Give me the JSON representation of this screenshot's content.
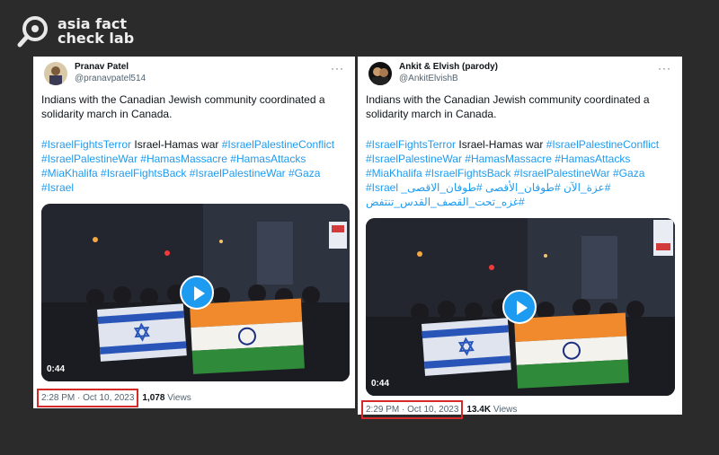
{
  "brand": {
    "line1": "asia fact",
    "line2": "check lab"
  },
  "colors": {
    "link": "#1d9bf0",
    "highlight": "#d62a2a",
    "background": "#2b2b2b"
  },
  "tweets": [
    {
      "display_name": "Pranav Patel",
      "handle": "@pranavpatel514",
      "more": "···",
      "text": "Indians with the Canadian Jewish community coordinated a solidarity march in Canada.",
      "tag_lines": [
        [
          "#IsraelFightsTerror",
          " Israel-Hamas war ",
          "#IsraelPalestineConflict"
        ],
        [
          "#IsraelPalestineWar #HamasMassacre #HamasAttacks"
        ],
        [
          "#MiaKhalifa #IsraelFightsBack #IsraelPalestineWar #Gaza"
        ],
        [
          "#Israel"
        ]
      ],
      "duration": "0:44",
      "timestamp": "2:28 PM · Oct 10, 2023",
      "views_count": "1,078",
      "views_label": "Views"
    },
    {
      "display_name": "Ankit & Elvish (parody)",
      "handle": "@AnkitElvishB",
      "more": "···",
      "text": "Indians with the Canadian Jewish community coordinated a solidarity march in Canada.",
      "tag_lines": [
        [
          "#IsraelFightsTerror",
          " Israel-Hamas war ",
          "#IsraelPalestineConflict"
        ],
        [
          "#IsraelPalestineWar #HamasMassacre #HamasAttacks"
        ],
        [
          "#MiaKhalifa #IsraelFightsBack #IsraelPalestineWar #Gaza"
        ],
        [
          "#Israel",
          "#عزة_الآن #طوفان_الأقصى #طوفان_الاقصى_"
        ],
        [
          "#غزه_تحت_القصف_القدس_تنتفض"
        ]
      ],
      "duration": "0:44",
      "timestamp": "2:29 PM · Oct 10, 2023",
      "views_count": "13.4K",
      "views_label": "Views"
    }
  ]
}
